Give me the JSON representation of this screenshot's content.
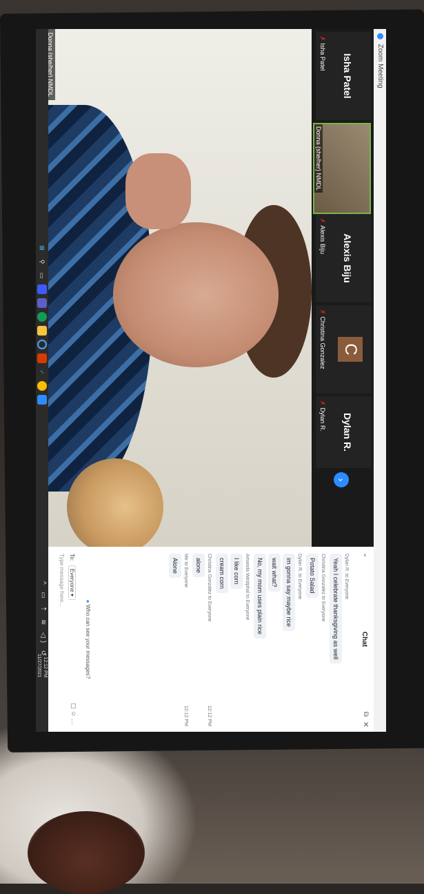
{
  "window": {
    "title": "Zoom Meeting"
  },
  "participants": [
    {
      "name": "Isha Patel",
      "label": "Isha Patel",
      "muted": true
    },
    {
      "name": "",
      "label": "Donna (she/her) NMDL",
      "muted": false
    },
    {
      "name": "Alexis Biju",
      "label": "Alexis Biju",
      "muted": true
    },
    {
      "name": "C",
      "label": "Christina Gonzalez",
      "muted": true
    },
    {
      "name": "Dylan R.",
      "label": "Dylan R.",
      "muted": true
    }
  ],
  "next_icon": "chevron-right-icon",
  "active_speaker": {
    "label": "Donna (she/her) NMDL"
  },
  "chat": {
    "title": "Chat",
    "messages": [
      {
        "sender": "Dylan R. to Everyone",
        "time": "",
        "text": "Yeah I celebrate thanksgiving as well"
      },
      {
        "sender": "Christina Gonzalez to Everyone",
        "time": "",
        "text": "Potato Salad"
      },
      {
        "sender": "Dylan R. to Everyone",
        "time": "",
        "text": "im gonna say maybe rice"
      },
      {
        "sender": "",
        "time": "",
        "text": "wait what?"
      },
      {
        "sender": "",
        "time": "",
        "text": "No, my mom uses plain rice"
      },
      {
        "sender": "Amanda Westphal to Everyone",
        "time": "",
        "text": "I like corn"
      },
      {
        "sender": "",
        "time": "",
        "text": "cream corn"
      },
      {
        "sender": "Christina Gonzalez to Everyone",
        "time": "12:12 PM",
        "text": "alone"
      },
      {
        "sender": "Me to Everyone",
        "time": "12:12 PM",
        "text": "Alone"
      }
    ],
    "who_can_see": "Who can see your messages?",
    "to_label": "To:",
    "to_value": "Everyone",
    "input_placeholder": "Type message here..."
  },
  "taskbar": {
    "time": "12:12 PM",
    "date": "11/27/2021",
    "icons": [
      "windows-start-icon",
      "search-icon",
      "task-view-icon",
      "widgets-icon",
      "teams-chat-icon",
      "edge-icon",
      "file-explorer-icon",
      "cortana-icon",
      "office-icon",
      "vscode-icon",
      "chrome-icon",
      "zoom-icon"
    ]
  },
  "colors": {
    "zoom_blue": "#2d8cff",
    "mute_red": "#e02828",
    "active_speaker_border": "#7ab648"
  }
}
